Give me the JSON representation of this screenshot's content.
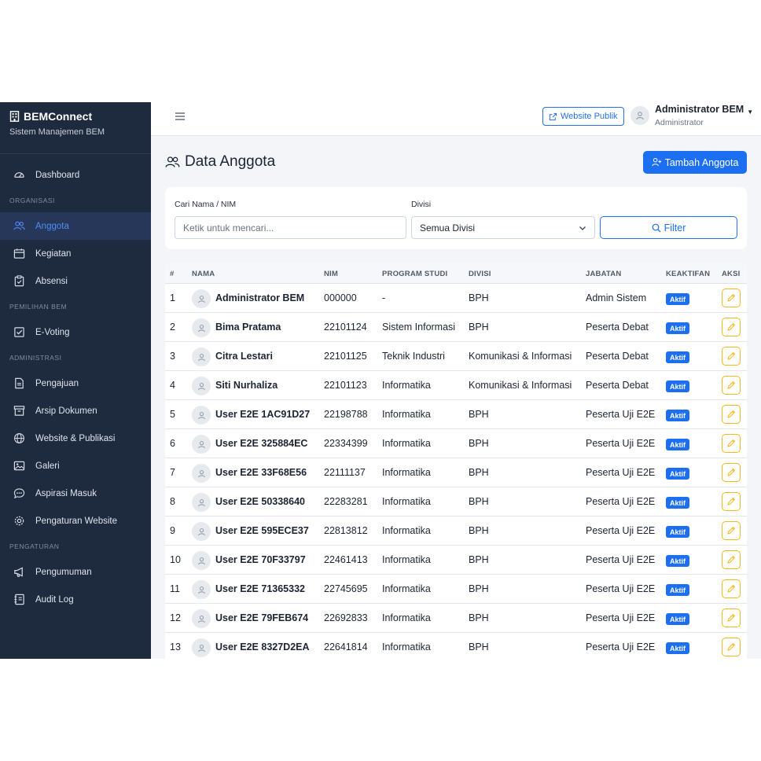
{
  "brand": {
    "title": "BEMConnect",
    "subtitle": "Sistem Manajemen BEM"
  },
  "sidebar": {
    "dashboard": "Dashboard",
    "section_org": "ORGANISASI",
    "anggota": "Anggota",
    "kegiatan": "Kegiatan",
    "absensi": "Absensi",
    "section_pemilihan": "PEMILIHAN BEM",
    "evoting": "E-Voting",
    "section_admin": "ADMINISTRASI",
    "pengajuan": "Pengajuan",
    "arsip": "Arsip Dokumen",
    "website": "Website & Publikasi",
    "galeri": "Galeri",
    "aspirasi": "Aspirasi Masuk",
    "pengaturan_web": "Pengaturan Website",
    "section_pengaturan": "PENGATURAN",
    "pengumuman": "Pengumuman",
    "audit": "Audit Log"
  },
  "topbar": {
    "public_site": "Website Publik",
    "user_name": "Administrator BEM",
    "user_role": "Administrator"
  },
  "page": {
    "title": "Data Anggota",
    "add_button": "Tambah Anggota"
  },
  "filter": {
    "search_label": "Cari Nama / NIM",
    "search_placeholder": "Ketik untuk mencari...",
    "division_label": "Divisi",
    "division_value": "Semua Divisi",
    "filter_button": "Filter"
  },
  "table": {
    "headers": {
      "no": "#",
      "name": "NAMA",
      "nim": "NIM",
      "prodi": "PROGRAM STUDI",
      "divisi": "DIVISI",
      "jabatan": "JABATAN",
      "keaktifan": "KEAKTIFAN",
      "aksi": "AKSI"
    },
    "rows": [
      {
        "no": "1",
        "name": "Administrator BEM",
        "nim": "000000",
        "prodi": "-",
        "divisi": "BPH",
        "jabatan": "Admin Sistem",
        "status": "Aktif"
      },
      {
        "no": "2",
        "name": "Bima Pratama",
        "nim": "22101124",
        "prodi": "Sistem Informasi",
        "divisi": "BPH",
        "jabatan": "Peserta Debat",
        "status": "Aktif"
      },
      {
        "no": "3",
        "name": "Citra Lestari",
        "nim": "22101125",
        "prodi": "Teknik Industri",
        "divisi": "Komunikasi & Informasi",
        "jabatan": "Peserta Debat",
        "status": "Aktif"
      },
      {
        "no": "4",
        "name": "Siti Nurhaliza",
        "nim": "22101123",
        "prodi": "Informatika",
        "divisi": "Komunikasi & Informasi",
        "jabatan": "Peserta Debat",
        "status": "Aktif"
      },
      {
        "no": "5",
        "name": "User E2E 1AC91D27",
        "nim": "22198788",
        "prodi": "Informatika",
        "divisi": "BPH",
        "jabatan": "Peserta Uji E2E",
        "status": "Aktif"
      },
      {
        "no": "6",
        "name": "User E2E 325884EC",
        "nim": "22334399",
        "prodi": "Informatika",
        "divisi": "BPH",
        "jabatan": "Peserta Uji E2E",
        "status": "Aktif"
      },
      {
        "no": "7",
        "name": "User E2E 33F68E56",
        "nim": "22111137",
        "prodi": "Informatika",
        "divisi": "BPH",
        "jabatan": "Peserta Uji E2E",
        "status": "Aktif"
      },
      {
        "no": "8",
        "name": "User E2E 50338640",
        "nim": "22283281",
        "prodi": "Informatika",
        "divisi": "BPH",
        "jabatan": "Peserta Uji E2E",
        "status": "Aktif"
      },
      {
        "no": "9",
        "name": "User E2E 595ECE37",
        "nim": "22813812",
        "prodi": "Informatika",
        "divisi": "BPH",
        "jabatan": "Peserta Uji E2E",
        "status": "Aktif"
      },
      {
        "no": "10",
        "name": "User E2E 70F33797",
        "nim": "22461413",
        "prodi": "Informatika",
        "divisi": "BPH",
        "jabatan": "Peserta Uji E2E",
        "status": "Aktif"
      },
      {
        "no": "11",
        "name": "User E2E 71365332",
        "nim": "22745695",
        "prodi": "Informatika",
        "divisi": "BPH",
        "jabatan": "Peserta Uji E2E",
        "status": "Aktif"
      },
      {
        "no": "12",
        "name": "User E2E 79FEB674",
        "nim": "22692833",
        "prodi": "Informatika",
        "divisi": "BPH",
        "jabatan": "Peserta Uji E2E",
        "status": "Aktif"
      },
      {
        "no": "13",
        "name": "User E2E 8327D2EA",
        "nim": "22641814",
        "prodi": "Informatika",
        "divisi": "BPH",
        "jabatan": "Peserta Uji E2E",
        "status": "Aktif"
      }
    ]
  },
  "colors": {
    "sidebar_bg": "#1e2a3d",
    "primary": "#1d6ff2",
    "edit_border": "#f5b81c",
    "active_nav": "#4f8df7"
  }
}
